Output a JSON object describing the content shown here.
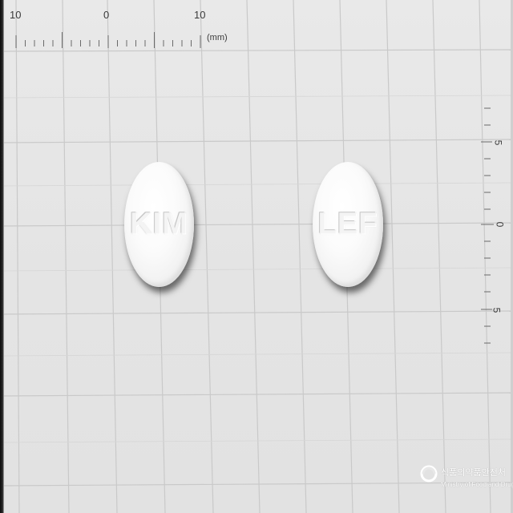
{
  "ruler_top": {
    "labels": [
      "10",
      "0",
      "10"
    ],
    "unit": "(mm)"
  },
  "ruler_right": {
    "labels": [
      "5",
      "0",
      "5"
    ]
  },
  "pills": [
    {
      "imprint": "KIM",
      "color": "#fafafa",
      "shape": "round"
    },
    {
      "imprint": "LEF",
      "color": "#fafafa",
      "shape": "round"
    }
  ],
  "watermark": {
    "agency_korean": "식품의약품안전처",
    "agency_english": "Ministry of Food and Drug Safety"
  }
}
